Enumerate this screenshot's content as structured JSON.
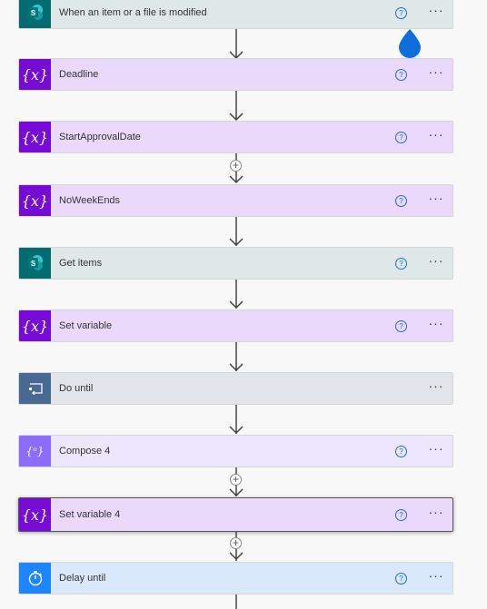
{
  "steps": [
    {
      "title": "When an item or a file is modified",
      "icon": "sharepoint-icon",
      "kind": "sp",
      "help": "?",
      "more": "···"
    },
    {
      "title": "Deadline",
      "icon": "variable-icon",
      "kind": "var",
      "help": "?",
      "more": "···"
    },
    {
      "title": "StartApprovalDate",
      "icon": "variable-icon",
      "kind": "var",
      "help": "?",
      "more": "···"
    },
    {
      "title": "NoWeekEnds",
      "icon": "variable-icon",
      "kind": "var",
      "help": "?",
      "more": "···"
    },
    {
      "title": "Get items",
      "icon": "sharepoint-icon",
      "kind": "sp",
      "help": "?",
      "more": "···"
    },
    {
      "title": "Set variable",
      "icon": "variable-icon",
      "kind": "var",
      "help": "?",
      "more": "···"
    },
    {
      "title": "Do until",
      "icon": "loop-icon",
      "kind": "until",
      "more": "···"
    },
    {
      "title": "Compose 4",
      "icon": "compose-icon",
      "kind": "compose",
      "help": "?",
      "more": "···"
    },
    {
      "title": "Set variable 4",
      "icon": "variable-icon",
      "kind": "var",
      "help": "?",
      "more": "···"
    },
    {
      "title": "Delay until",
      "icon": "timer-icon",
      "kind": "delay",
      "help": "?",
      "more": "···"
    }
  ],
  "plus_symbol": "+",
  "colors": {
    "variable": "#770bd6",
    "sharepoint": "#036c70",
    "do_until": "#486991",
    "compose": "#8c6cff",
    "delay": "#1f85ff",
    "accent_help": "#1b6ed0"
  }
}
